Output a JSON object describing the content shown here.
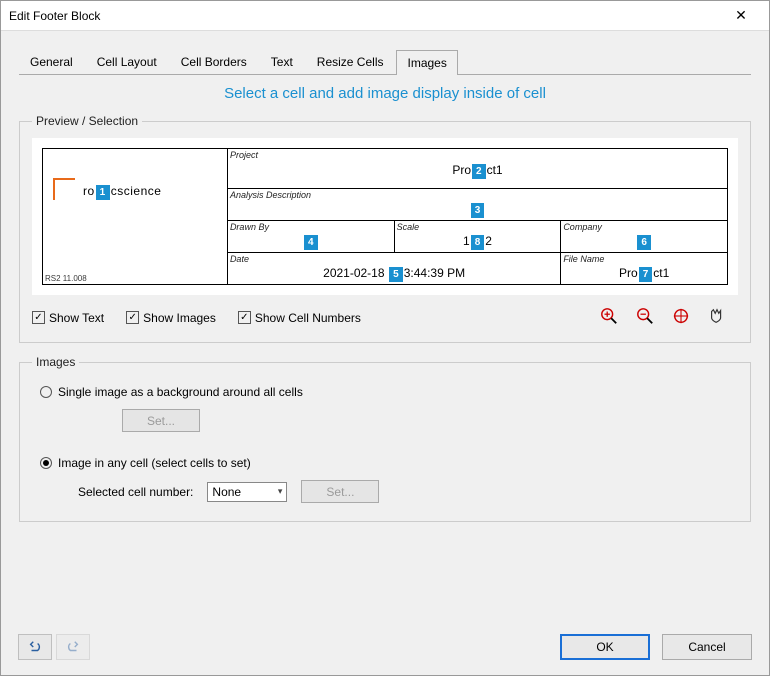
{
  "window": {
    "title": "Edit Footer Block"
  },
  "tabs": [
    "General",
    "Cell Layout",
    "Cell Borders",
    "Text",
    "Resize Cells",
    "Images"
  ],
  "active_tab": "Images",
  "instruction": "Select a cell and add image display inside of cell",
  "preview": {
    "legend": "Preview / Selection",
    "cells": {
      "logo": {
        "brand": "ro",
        "brand2": "cscience",
        "version": "RS2 11.008",
        "badge": "1"
      },
      "project": {
        "label": "Project",
        "value_pre": "Pro",
        "badge": "2",
        "value_post": "ct1"
      },
      "analysis": {
        "label": "Analysis Description",
        "badge": "3"
      },
      "drawn": {
        "label": "Drawn By",
        "badge": "4"
      },
      "scale": {
        "label": "Scale",
        "pre": "1",
        "badge": "8",
        "post": "2"
      },
      "company": {
        "label": "Company",
        "badge": "6"
      },
      "date": {
        "label": "Date",
        "pre": "2021-02-18",
        "badge": "5",
        "post": "3:44:39 PM"
      },
      "filename": {
        "label": "File Name",
        "pre": "Pro",
        "badge": "7",
        "post": "ct1"
      }
    },
    "checks": {
      "show_text": "Show Text",
      "show_images": "Show Images",
      "show_cell_numbers": "Show Cell Numbers"
    }
  },
  "images_panel": {
    "legend": "Images",
    "opt_single": "Single image as a background around all cells",
    "opt_any": "Image in any cell (select cells to set)",
    "set": "Set...",
    "selected_label": "Selected cell number:",
    "selected_value": "None"
  },
  "footer": {
    "ok": "OK",
    "cancel": "Cancel"
  }
}
